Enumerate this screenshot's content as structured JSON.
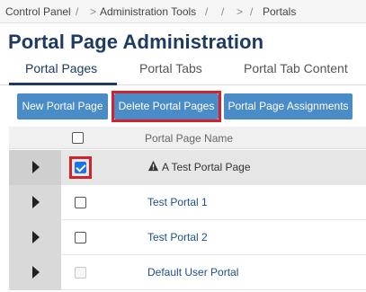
{
  "breadcrumb": {
    "items": [
      "Control Panel",
      "Administration Tools",
      "",
      "Portals"
    ],
    "separator": "/",
    "prefix": ">"
  },
  "page_title": "Portal Page Administration",
  "tabs": [
    {
      "label": "Portal Pages",
      "active": true
    },
    {
      "label": "Portal Tabs",
      "active": false
    },
    {
      "label": "Portal Tab Content",
      "active": false
    }
  ],
  "toolbar": {
    "new_label": "New Portal Page",
    "delete_label": "Delete Portal Pages",
    "assign_label": "Portal Page Assignments"
  },
  "grid": {
    "header_label": "Portal Page Name",
    "rows": [
      {
        "name": "A Test Portal Page",
        "checked": true,
        "warning": true,
        "link": false
      },
      {
        "name": "Test Portal 1",
        "checked": false,
        "warning": false,
        "link": true
      },
      {
        "name": "Test Portal 2",
        "checked": false,
        "warning": false,
        "link": true
      },
      {
        "name": "Default User Portal",
        "checked": false,
        "disabled": true,
        "warning": false,
        "link": true
      }
    ]
  },
  "colors": {
    "accent": "#4a8cc7",
    "title": "#1e3a63",
    "highlight_box": "#d2232a",
    "link": "#1e4e8c"
  }
}
